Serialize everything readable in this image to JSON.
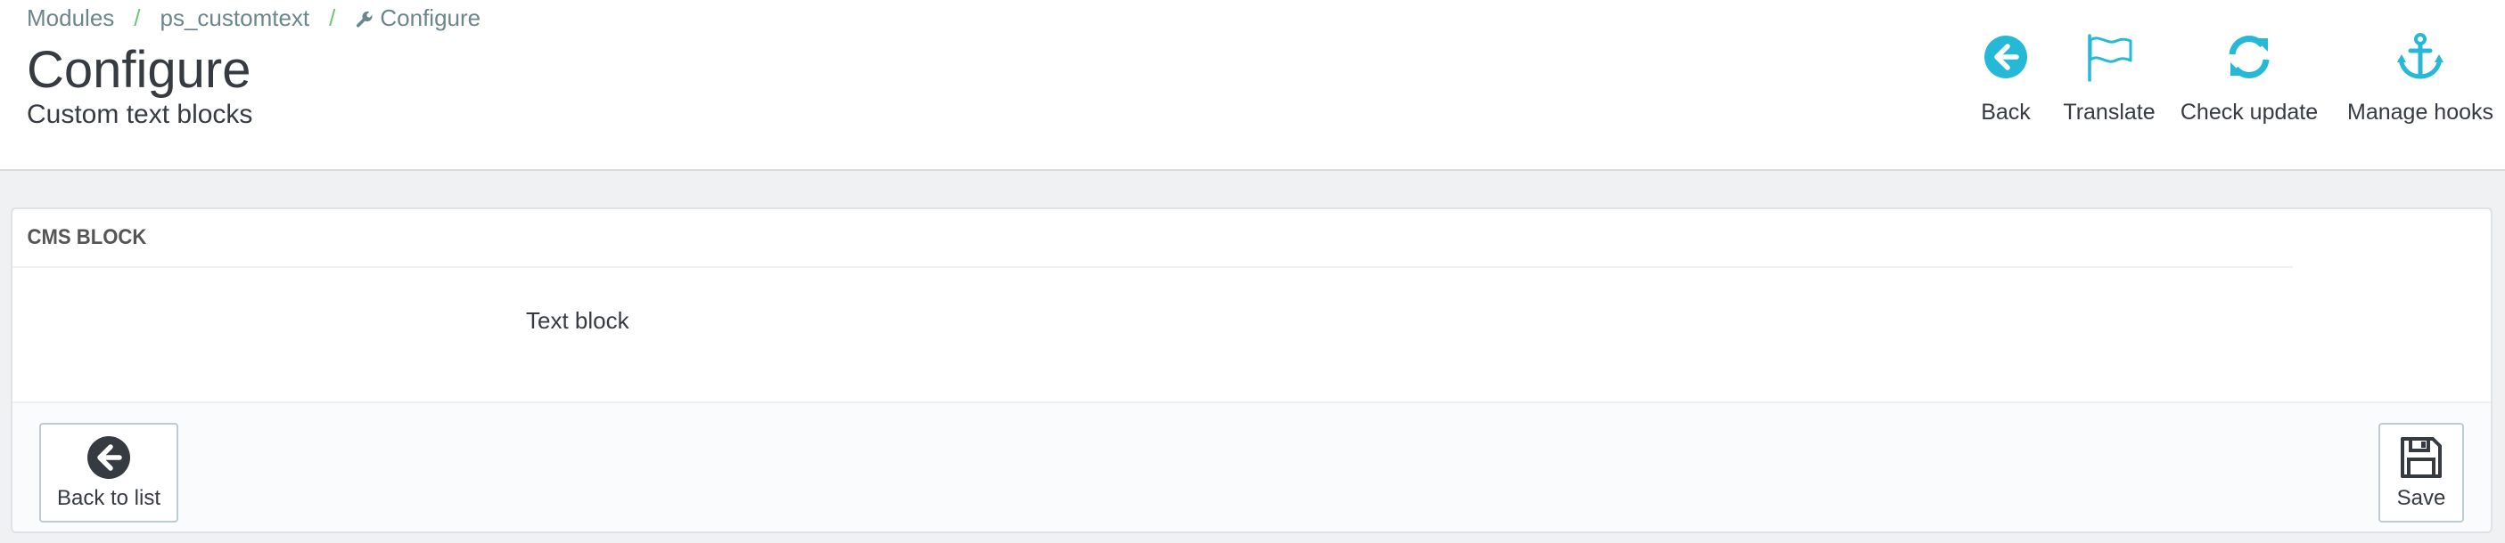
{
  "breadcrumb": {
    "items": [
      "Modules",
      "ps_customtext",
      "Configure"
    ],
    "separator": "/",
    "current_icon": "wrench-icon"
  },
  "header": {
    "title": "Configure",
    "subtitle": "Custom text blocks"
  },
  "toolbar": {
    "accent_color": "#25b9d7",
    "buttons": [
      {
        "label": "Back",
        "icon": "arrow-circle-left-icon"
      },
      {
        "label": "Translate",
        "icon": "flag-icon"
      },
      {
        "label": "Check update",
        "icon": "refresh-icon"
      },
      {
        "label": "Manage hooks",
        "icon": "anchor-icon"
      }
    ]
  },
  "panel": {
    "heading": "CMS BLOCK",
    "field_label": "Text block",
    "footer": {
      "back_label": "Back to list",
      "back_icon": "arrow-circle-left-icon",
      "save_label": "Save",
      "save_icon": "floppy-disk-icon"
    }
  }
}
